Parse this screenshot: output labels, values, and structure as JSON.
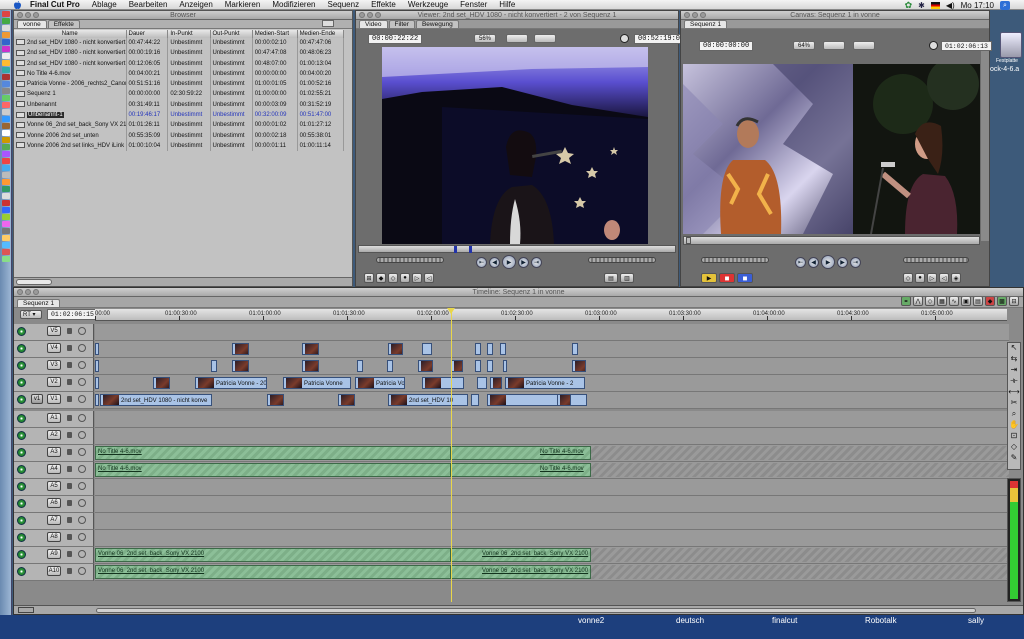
{
  "menubar": {
    "app": "Final Cut Pro",
    "items": [
      "Ablage",
      "Bearbeiten",
      "Anzeigen",
      "Markieren",
      "Modifizieren",
      "Sequenz",
      "Effekte",
      "Werkzeuge",
      "Fenster",
      "Hilfe"
    ],
    "clock": "Mo 17:10"
  },
  "browser": {
    "title": "Browser",
    "tabs": [
      "vonne",
      "Effekte"
    ],
    "columns": [
      "Name",
      "Dauer",
      "In-Punkt",
      "Out-Punkt",
      "Medien-Start",
      "Medien-Ende"
    ],
    "rows": [
      [
        "2nd set_HDV 1080 - nicht konvertiert",
        "00:47:44:22",
        "Unbestimmt",
        "Unbestimmt",
        "00:00:02:10",
        "00:47:47:06"
      ],
      [
        "2nd set_HDV 1080 - nicht konvertiert",
        "00:00:19:16",
        "Unbestimmt",
        "Unbestimmt",
        "00:47:47:08",
        "00:48:06:23"
      ],
      [
        "2nd set_HDV 1080 - nicht konvertiert",
        "00:12:06:05",
        "Unbestimmt",
        "Unbestimmt",
        "00:48:07:00",
        "01:00:13:04"
      ],
      [
        "No Title 4-6.mov",
        "00:04:00:21",
        "Unbestimmt",
        "Unbestimmt",
        "00:00:00:00",
        "00:04:00:20"
      ],
      [
        "Patricia Vonne - 2006_rechts2_Canon",
        "00:51:51:16",
        "Unbestimmt",
        "Unbestimmt",
        "01:00:01:05",
        "01:00:52:16"
      ],
      [
        "Sequenz 1",
        "00:00:00:00",
        "02:30:59:22",
        "Unbestimmt",
        "01:00:00:00",
        "01:02:55:21"
      ],
      [
        "Unbenannt",
        "00:31:49:11",
        "Unbestimmt",
        "Unbestimmt",
        "00:00:03:09",
        "00:31:52:19"
      ],
      [
        "Unbenannt-1",
        "00:19:46:17",
        "Unbestimmt",
        "Unbestimmt",
        "00:32:00:09",
        "00:51:47:00"
      ],
      [
        "Vonne 06_2nd set_back_Sony VX 2100",
        "01:01:26:11",
        "Unbestimmt",
        "Unbestimmt",
        "00:00:01:02",
        "01:01:27:12"
      ],
      [
        "Vonne 2006 2nd set_unten",
        "00:55:35:09",
        "Unbestimmt",
        "Unbestimmt",
        "00:00:02:18",
        "00:55:38:01"
      ],
      [
        "Vonne 2006 2nd set links_HDV iLink",
        "01:00:10:04",
        "Unbestimmt",
        "Unbestimmt",
        "00:00:01:11",
        "01:00:11:14"
      ]
    ],
    "selected_row": 7
  },
  "viewer": {
    "title": "Viewer: 2nd set_HDV 1080 - nicht konvertiert - 2 von Sequenz 1",
    "tabs": [
      "Video",
      "Filter",
      "Bewegung"
    ],
    "timecode_left": "00:00:22:22",
    "timecode_right": "00:52:19:00",
    "zoom": "56%"
  },
  "canvas": {
    "title": "Canvas: Sequenz 1 in vonne",
    "tab": "Sequenz 1",
    "timecode_left": "00:00:00:00",
    "timecode_right": "01:02:06:13",
    "zoom": "64%"
  },
  "timeline": {
    "title": "Timeline: Sequenz 1 in vonne",
    "tab": "Sequenz 1",
    "rt_label": "RT",
    "current_tc": "01:02:06:15",
    "ruler": [
      "00:00",
      "01:00:30:00",
      "01:01:00:00",
      "01:01:30:00",
      "01:02:00:00",
      "01:02:30:00",
      "01:03:00:00",
      "01:03:30:00",
      "01:04:00:00",
      "01:04:30:00",
      "01:05:00:00"
    ],
    "video_tracks": [
      "V5",
      "V4",
      "V3",
      "V2",
      "V1"
    ],
    "audio_tracks": [
      "A1",
      "A2",
      "A3",
      "A4",
      "A5",
      "A6",
      "A7",
      "A8",
      "A9",
      "A10"
    ],
    "source_v": "v1",
    "clip_patricia": "Patricia Vonne - 20",
    "clip_patricia_short": "Patricia Vonne",
    "clip_patricia_vo": "Patricia Vo",
    "clip_patricia2": "Patricia Vonne - 2",
    "clip_hdv": "2nd set_HDV 1080 - nicht konve",
    "clip_hdv2": "2nd set_HDV 10",
    "audio_no_title": "No Title 4-6.mov",
    "audio_vonne": "Vonne 06_2nd set_back_Sony VX 2100"
  },
  "desktop": {
    "disk_label": "Festplatte",
    "file_label": "ock-4-6.a"
  },
  "dock_labels": [
    "vonne2",
    "deutsch",
    "finalcut",
    "Robotalk",
    "sally"
  ]
}
